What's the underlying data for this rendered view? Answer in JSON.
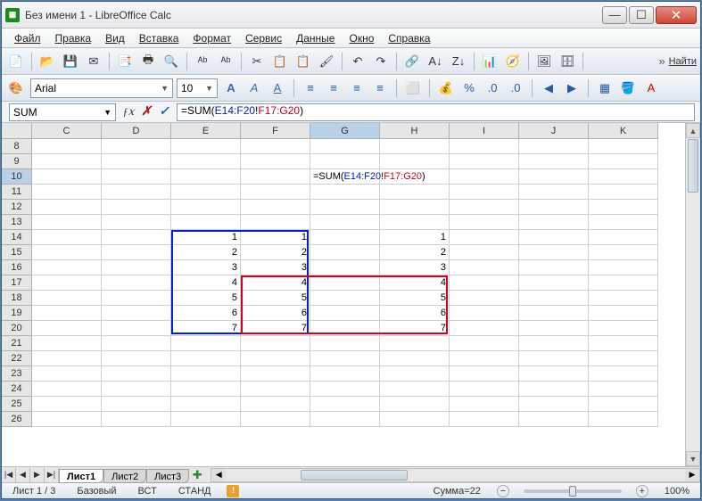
{
  "window": {
    "title": "Без имени 1 - LibreOffice Calc"
  },
  "menu": {
    "file": "Файл",
    "edit": "Правка",
    "view": "Вид",
    "insert": "Вставка",
    "format": "Формат",
    "tools": "Сервис",
    "data": "Данные",
    "window": "Окно",
    "help": "Справка"
  },
  "toolbar": {
    "find_label": "Найти"
  },
  "font": {
    "name": "Arial",
    "size": "10"
  },
  "namebox": "SUM",
  "formula": {
    "prefix": "=SUM(",
    "range1": "E14:F20",
    "sep": "!",
    "range2": "F17:G20",
    "suffix": ")"
  },
  "columns": [
    "C",
    "D",
    "E",
    "F",
    "G",
    "H",
    "I",
    "J",
    "K"
  ],
  "active_col": "G",
  "rows": [
    8,
    9,
    10,
    11,
    12,
    13,
    14,
    15,
    16,
    17,
    18,
    19,
    20,
    21,
    22,
    23,
    24,
    25,
    26
  ],
  "active_row": 10,
  "cell_data": {
    "14": {
      "E": "1",
      "F": "1",
      "H": "1"
    },
    "15": {
      "E": "2",
      "F": "2",
      "H": "2"
    },
    "16": {
      "E": "3",
      "F": "3",
      "H": "3"
    },
    "17": {
      "E": "4",
      "F": "4",
      "H": "4"
    },
    "18": {
      "E": "5",
      "F": "5",
      "H": "5"
    },
    "19": {
      "E": "6",
      "F": "6",
      "H": "6"
    },
    "20": {
      "E": "7",
      "F": "7",
      "H": "7"
    }
  },
  "editing_cell": {
    "row": 10,
    "col": "G"
  },
  "range_blue": {
    "c1": "E",
    "r1": 14,
    "c2": "F",
    "r2": 20
  },
  "range_red": {
    "c1": "F",
    "r1": 17,
    "c2": "H",
    "r2": 20
  },
  "tabs": {
    "nav": [
      "|◀",
      "◀",
      "▶",
      "▶|"
    ],
    "sheets": [
      "Лист1",
      "Лист2",
      "Лист3"
    ],
    "active": 0
  },
  "status": {
    "sheet": "Лист 1 / 3",
    "style": "Базовый",
    "insert": "ВСТ",
    "mode": "СТАНД",
    "sum": "Сумма=22",
    "zoom": "100%"
  }
}
